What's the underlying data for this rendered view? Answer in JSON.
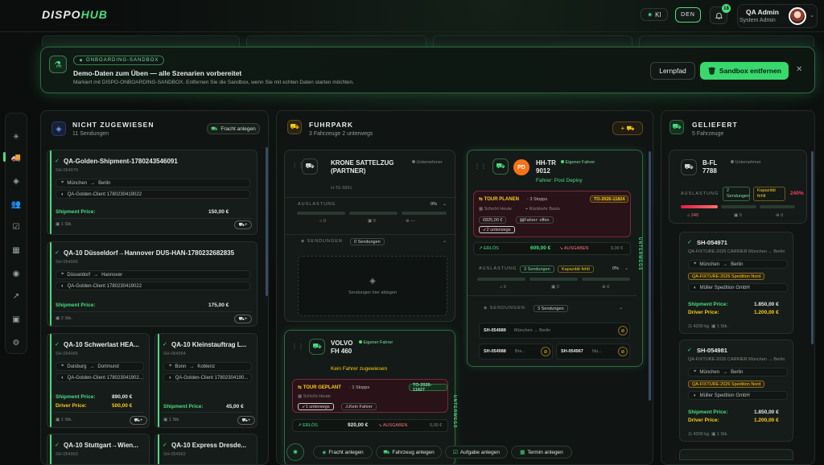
{
  "app": {
    "logo_main": "DISPO",
    "logo_accent": "HUB"
  },
  "topbar": {
    "ki_label": "KI",
    "lang_label": "DEN",
    "notification_count": "18",
    "user_name": "QA Admin",
    "user_role": "System Admin"
  },
  "banner": {
    "tag": "ONBOARDING-SANDBOX",
    "title": "Demo-Daten zum Üben — alle Szenarien vorbereitet",
    "subtitle": "Markiert mit DISPO-ONBOARDING-SANDBOX. Entfernen Sie die Sandbox, wenn Sie mit echten Daten starten möchten.",
    "lernpfad_label": "Lernpfad",
    "remove_label": "Sandbox entfernen"
  },
  "columns": {
    "unassigned": {
      "title": "NICHT ZUGEWIESEN",
      "subtitle": "11 Sendungen",
      "action_label": "Fracht anlegen",
      "cards": [
        {
          "title": "QA-Golden-Shipment-1780243546091",
          "id": "SH-054979",
          "from": "München",
          "to": "Berlin",
          "client": "QA-Golden-Client 1780230419022",
          "price_label": "Shipment Price:",
          "price": "150,00 €",
          "meta": "1 Stk."
        },
        {
          "title": "QA-10 Düsseldorf→Hannover DUS-HAN-1780232682835",
          "id": "SH-054966",
          "from": "Düsseldorf",
          "to": "Hannover",
          "client": "QA-Golden-Client 1780230419022",
          "price_label": "Shipment Price:",
          "price": "175,00 €",
          "meta": "2 Stk."
        },
        {
          "title": "QA-10 Schwerlast HEA...",
          "id": "SH-054965",
          "from": "Duisburg",
          "to": "Dortmund",
          "client": "QA-Golden-Client 178023041902...",
          "price_label": "Shipment Price:",
          "price": "890,00 €",
          "driver_label": "Driver Price:",
          "driver_price": "500,00 €",
          "meta": "1 Stk."
        },
        {
          "title": "QA-10 Kleinstauftrag L...",
          "id": "SH-054964",
          "from": "Bonn",
          "to": "Koblenz",
          "client": "QA-Golden-Client 17802304190...",
          "price_label": "Shipment Price:",
          "price": "45,00 €",
          "meta": "1 Stk."
        },
        {
          "title": "QA-10 Stuttgart→Wien...",
          "id": "SH-054963"
        },
        {
          "title": "QA-10 Express Dresde...",
          "id": "SH-054962"
        }
      ]
    },
    "fleet": {
      "title": "FUHRPARK",
      "subtitle": "3 Fahrzeuge 2 unterwegs",
      "trucks": [
        {
          "name": "KRONE SATTELZUG (PARTNER)",
          "plate": "H-TE 6891",
          "type": "Unternehmer",
          "load_label": "AUSLASTUNG",
          "load_pct": "0%",
          "c1": "0",
          "c2": "0",
          "c3": "—",
          "shipments_label": "SENDUNGEN",
          "shipments_badge": "0 Sendungen",
          "drop_hint": "Sendungen hier ablegen"
        },
        {
          "name": "HH-TR 9012",
          "type": "Eigener Fahrer",
          "initials": "PD",
          "driver": "Fahrer: Post Deploy",
          "tour_label": "TOUR PLANEN",
          "tour_stops": "3 Stopps",
          "tour_id": "TO-2026-11824",
          "tour_shift": "Schicht Heute",
          "tour_return": "Rückkehr Basis",
          "tour_amount": "825,00 €",
          "tour_driver": "Fahrer: offen",
          "tour_transit": "2 unterwegs",
          "revenue_label": "ERLÖS",
          "revenue": "609,00 €",
          "expense_label": "AUSGABEN",
          "expense": "0,00 €",
          "load_label": "AUSLASTUNG",
          "load_badge": "3 Sendungen",
          "capacity_badge": "Kapazität fehlt",
          "load_pct": "0%",
          "c1": "0",
          "c2": "0",
          "c3": "0",
          "shipments_label": "SENDUNGEN",
          "shipments_badge": "3 Sendungen",
          "status": "UNTERWEGS",
          "rows": [
            {
              "id": "SH-054989",
              "route": "München → Berlin"
            },
            {
              "id": "SH-054988",
              "route": "Bre..."
            },
            {
              "id": "SH-054967",
              "route": "Nü..."
            }
          ]
        },
        {
          "name": "VOLVO FH 460",
          "type": "Eigener Fahrer",
          "driver": "Kein Fahrer zugewiesen",
          "tour_label": "TOUR GEPLANT",
          "tour_stops": "1 Stopps",
          "tour_id": "TO-2026-11827",
          "tour_shift": "Schicht Heute",
          "tour_transit": "1 unterwegs",
          "tour_driver": "Kein Fahrer",
          "revenue_label": "ERLÖS",
          "revenue": "920,00 €",
          "expense_label": "AUSGABEN",
          "expense": "0,00 €",
          "status": "UNTERWEGS"
        }
      ]
    },
    "delivered": {
      "title": "GELIEFERT",
      "subtitle": "5 Fahrzeuge",
      "truck": {
        "name": "B-FL 7788",
        "type": "Unternehmer",
        "load_label": "AUSLASTUNG",
        "load_badge": "2 Sendungen",
        "capacity_badge": "Kapazität fehlt",
        "load_pct": "240%",
        "c1": "240",
        "c2": "0",
        "c3": "0"
      },
      "cards": [
        {
          "id": "SH-054971",
          "title": "QA-FIXTURE-2026 CARRIER München → Berlin",
          "from": "München",
          "to": "Berlin",
          "carrier": "QA-FIXTURE-2026 Spedition Nord",
          "client": "Müller Spedition GmbH",
          "price_label": "Shipment Price:",
          "price": "1.850,00 €",
          "driver_label": "Driver Price:",
          "driver_price": "1.200,00 €",
          "weight": "4200 kg",
          "meta": "1 Stk."
        },
        {
          "id": "SH-054981",
          "title": "QA-FIXTURE-2026 CARRIER München → Berlin",
          "from": "München",
          "to": "Berlin",
          "carrier": "QA-FIXTURE-2026 Spedition Nord",
          "client": "Müller Spedition GmbH",
          "price_label": "Shipment Price:",
          "price": "1.850,00 €",
          "driver_label": "Driver Price:",
          "driver_price": "1.200,00 €",
          "weight": "4200 kg",
          "meta": "1 Stk."
        }
      ]
    }
  },
  "bottombar": {
    "b1": "Fracht anlegen",
    "b2": "Fahrzeug anlegen",
    "b3": "Aufgabe anlegen",
    "b4": "Termin anlegen"
  },
  "colors": {
    "accent": "#4ade80",
    "warning": "#facc15",
    "danger": "#e11d48"
  }
}
